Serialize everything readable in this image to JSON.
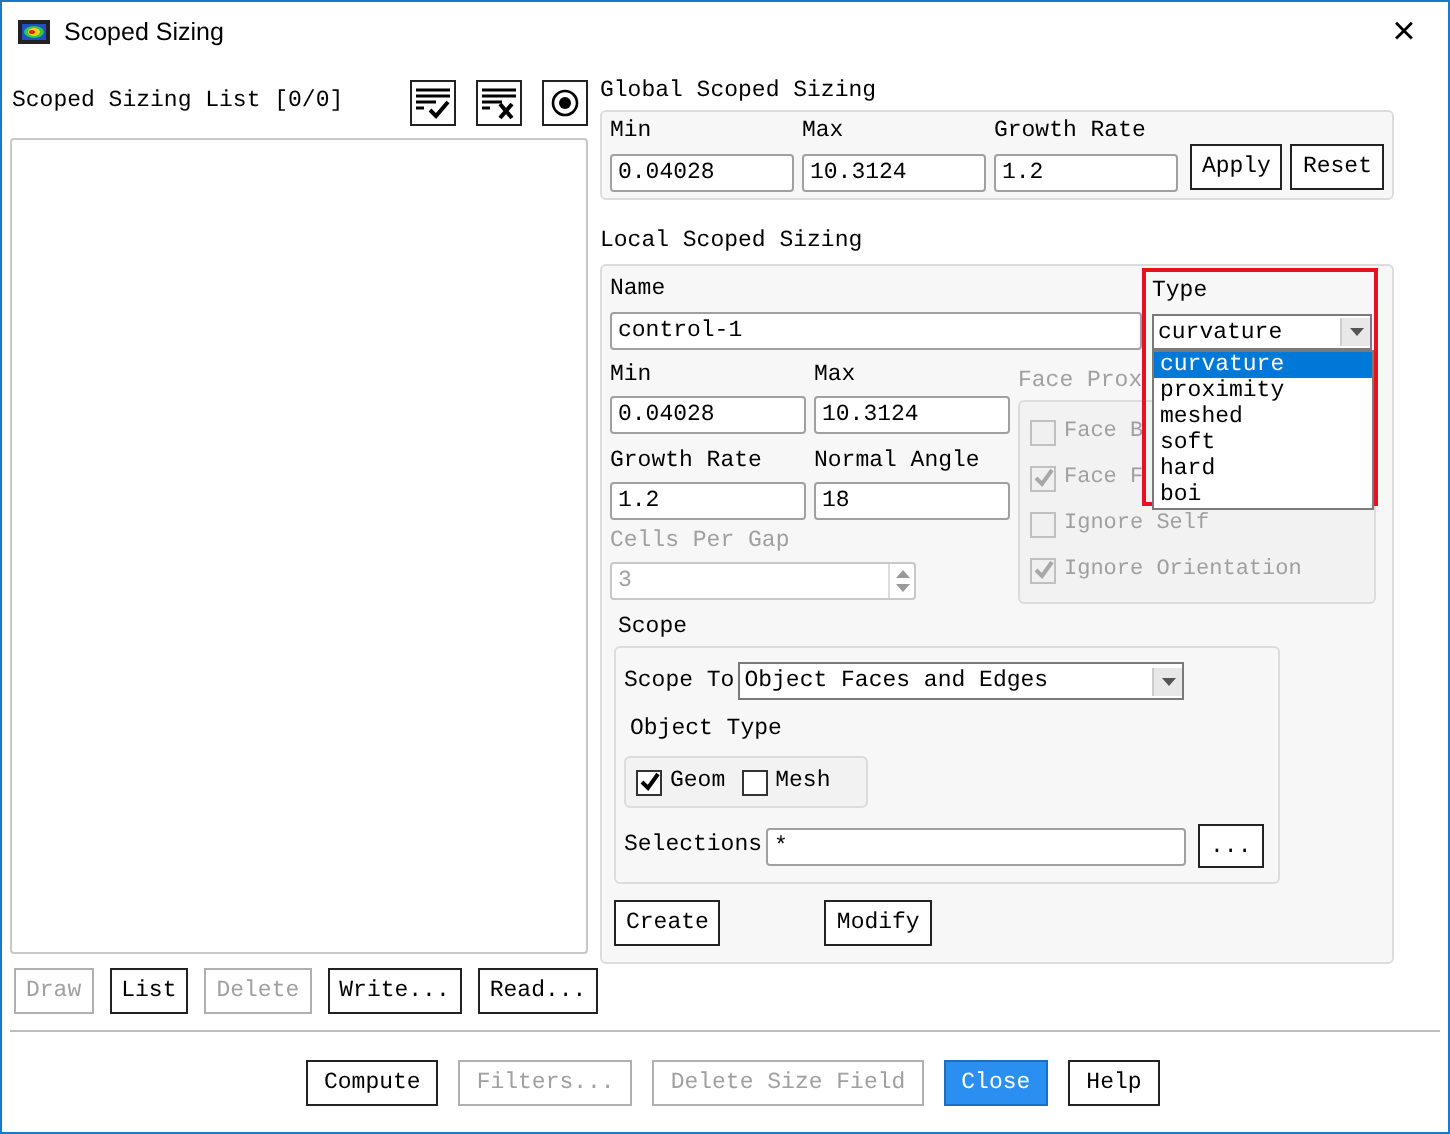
{
  "window": {
    "title": "Scoped Sizing",
    "close": "×"
  },
  "list_panel": {
    "title": "Scoped Sizing List [0/0]",
    "buttons": [
      {
        "label": "Draw",
        "disabled": true
      },
      {
        "label": "List",
        "disabled": false
      },
      {
        "label": "Delete",
        "disabled": true
      },
      {
        "label": "Write...",
        "disabled": false
      },
      {
        "label": "Read...",
        "disabled": false
      }
    ]
  },
  "global": {
    "title": "Global Scoped Sizing",
    "fields": [
      {
        "label": "Min",
        "value": "0.04028"
      },
      {
        "label": "Max",
        "value": "10.3124"
      },
      {
        "label": "Growth Rate",
        "value": "1.2"
      }
    ],
    "buttons": [
      "Apply",
      "Reset"
    ]
  },
  "local": {
    "title": "Local Scoped Sizing",
    "name": {
      "label": "Name",
      "value": "control-1"
    },
    "type": {
      "label": "Type",
      "value": "curvature",
      "expanded": true,
      "highlighted": true,
      "options": [
        {
          "label": "curvature",
          "selected": true
        },
        {
          "label": "proximity",
          "selected": false
        },
        {
          "label": "meshed",
          "selected": false
        },
        {
          "label": "soft",
          "selected": false
        },
        {
          "label": "hard",
          "selected": false
        },
        {
          "label": "boi",
          "selected": false
        }
      ]
    },
    "fields": [
      {
        "label": "Min",
        "value": "0.04028"
      },
      {
        "label": "Max",
        "value": "10.3124"
      },
      {
        "label": "Growth Rate",
        "value": "1.2"
      },
      {
        "label": "Normal Angle",
        "value": "18"
      }
    ],
    "cells_per_gap": {
      "label": "Cells Per Gap",
      "value": "3",
      "disabled": true
    },
    "face_proximity": {
      "title": "Face Prox",
      "disabled": true,
      "options": [
        {
          "label": "Face B",
          "checked": false
        },
        {
          "label": "Face F",
          "checked": true
        },
        {
          "label": "Ignore Self",
          "checked": false
        },
        {
          "label": "Ignore Orientation",
          "checked": true
        }
      ]
    },
    "scope": {
      "title": "Scope",
      "scope_to": {
        "label": "Scope To",
        "value": "Object Faces and Edges"
      },
      "object_type": {
        "title": "Object Type",
        "options": [
          {
            "label": "Geom",
            "checked": true
          },
          {
            "label": "Mesh",
            "checked": false
          }
        ]
      },
      "selections": {
        "label": "Selections",
        "value": "*",
        "button": "..."
      }
    },
    "buttons": [
      "Create",
      "Modify"
    ]
  },
  "footer_buttons": [
    {
      "label": "Compute",
      "disabled": false,
      "primary": false
    },
    {
      "label": "Filters...",
      "disabled": true,
      "primary": false
    },
    {
      "label": "Delete Size Field",
      "disabled": true,
      "primary": false
    },
    {
      "label": "Close",
      "disabled": false,
      "primary": true
    },
    {
      "label": "Help",
      "disabled": false,
      "primary": false
    }
  ]
}
